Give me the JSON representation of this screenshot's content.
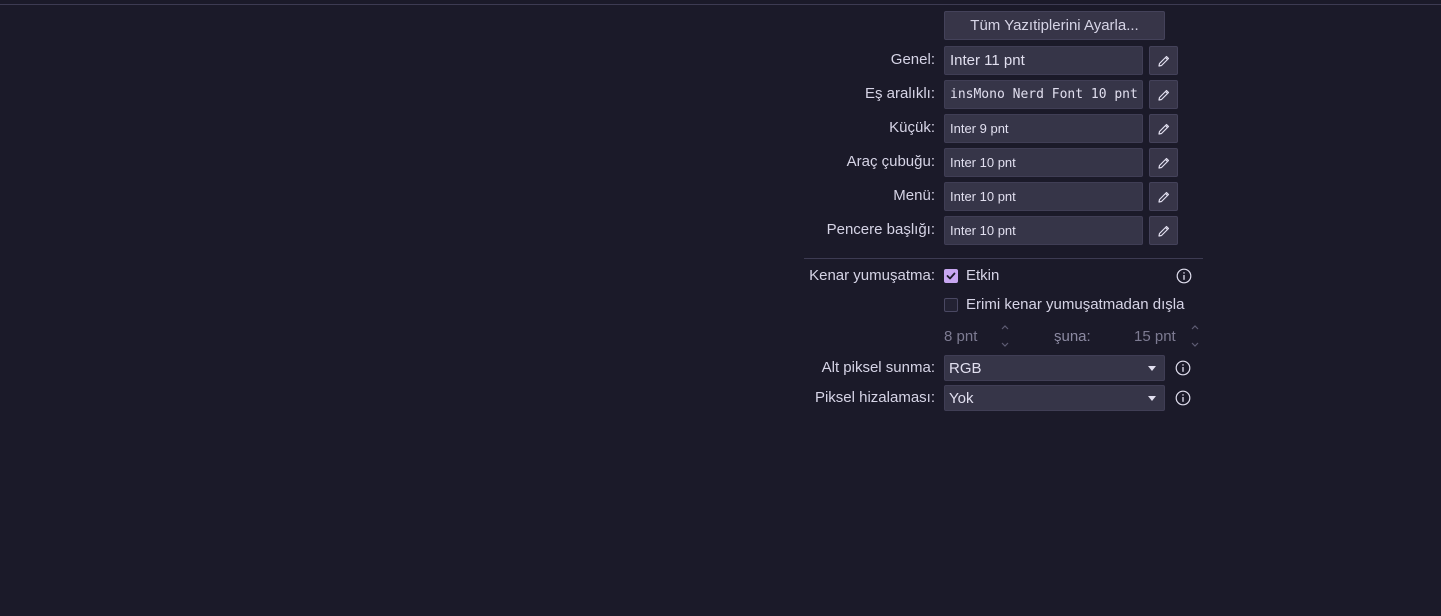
{
  "fonts": {
    "adjust_all_label": "Tüm Yazıtiplerini Ayarla...",
    "rows": [
      {
        "label": "Genel:",
        "value": "Inter 11 pnt"
      },
      {
        "label": "Eş aralıklı:",
        "value": "insMono Nerd Font 10 pnt"
      },
      {
        "label": "Küçük:",
        "value": "Inter 9 pnt"
      },
      {
        "label": "Araç çubuğu:",
        "value": "Inter 10 pnt"
      },
      {
        "label": "Menü:",
        "value": "Inter 10 pnt"
      },
      {
        "label": "Pencere başlığı:",
        "value": "Inter 10 pnt"
      }
    ]
  },
  "antialiasing": {
    "label": "Kenar yumuşatma:",
    "enabled_label": "Etkin",
    "enabled_checked": true,
    "exclude_label": "Erimi kenar yumuşatmadan dışla",
    "exclude_checked": false,
    "range_from": "8 pnt",
    "range_to_label": "şuna:",
    "range_to": "15 pnt"
  },
  "subpixel": {
    "label": "Alt piksel sunma:",
    "value": "RGB"
  },
  "hinting": {
    "label": "Piksel hizalaması:",
    "value": "Yok"
  },
  "colors": {
    "background": "#1b1a29",
    "accent": "#c7a6f0"
  },
  "icons": {
    "edit": "pencil-icon",
    "info": "info-icon",
    "dropdown": "chevron-down-icon",
    "check": "check-icon"
  }
}
